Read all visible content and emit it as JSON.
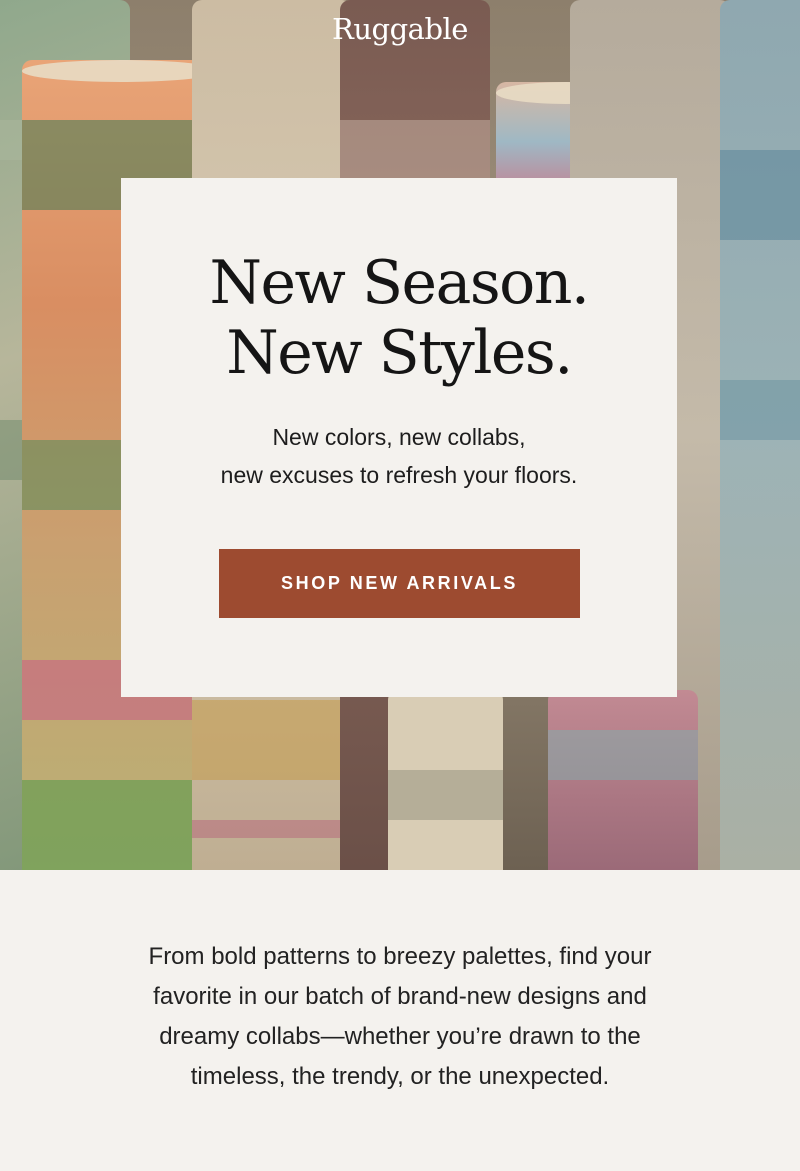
{
  "brand": {
    "logo_text": "Ruggable"
  },
  "hero": {
    "headline_line1": "New Season.",
    "headline_line2": "New Styles.",
    "subhead_line1": "New colors, new collabs,",
    "subhead_line2": "new excuses to refresh your floors.",
    "cta_label": "SHOP NEW ARRIVALS"
  },
  "body": {
    "lines": [
      "From bold patterns to breezy palettes, find your",
      "favorite in our batch of brand-new designs and",
      "dreamy collabs—whether you’re drawn to the",
      "timeless, the trendy, or the unexpected."
    ]
  },
  "colors": {
    "background": "#f4f2ee",
    "cta": "#9d4b30",
    "text": "#151515"
  }
}
